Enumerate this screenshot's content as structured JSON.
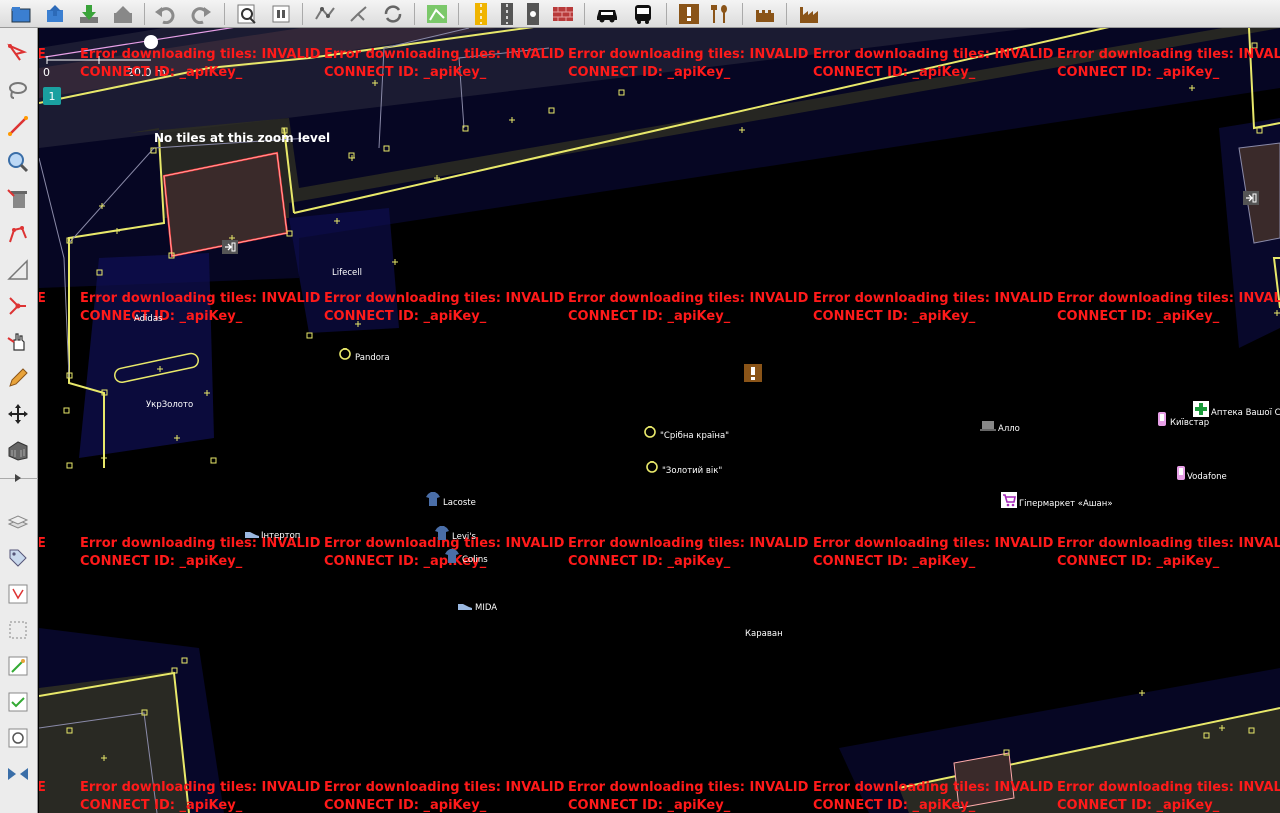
{
  "toolbar": {
    "buttons": [
      {
        "name": "open-file-button",
        "icon": "folder-open-icon"
      },
      {
        "name": "open-location-button",
        "icon": "globe-open-icon"
      },
      {
        "name": "download-button",
        "icon": "download-icon"
      },
      {
        "name": "upload-button",
        "icon": "upload-icon"
      },
      {
        "name": "undo-button",
        "icon": "undo-icon"
      },
      {
        "name": "redo-button",
        "icon": "redo-icon"
      },
      {
        "name": "preferences-button",
        "icon": "magnifier-icon"
      },
      {
        "name": "settings-button",
        "icon": "settings-panel-icon"
      },
      {
        "name": "split-way-button",
        "icon": "split-way-icon"
      },
      {
        "name": "combine-way-button",
        "icon": "combine-way-icon"
      },
      {
        "name": "reverse-way-button",
        "icon": "reverse-arrows-icon"
      },
      {
        "name": "filter-button",
        "icon": "filter-grid-icon"
      },
      {
        "name": "preset-road-button",
        "icon": "road-icon"
      },
      {
        "name": "preset-highway-button",
        "icon": "highway-icon"
      },
      {
        "name": "preset-traffic-light-button",
        "icon": "traffic-light-icon"
      },
      {
        "name": "preset-barrier-button",
        "icon": "brick-wall-icon"
      },
      {
        "name": "preset-car-button",
        "icon": "car-icon"
      },
      {
        "name": "preset-bus-button",
        "icon": "bus-icon"
      },
      {
        "name": "preset-warning-button",
        "icon": "exclamation-icon"
      },
      {
        "name": "preset-food-button",
        "icon": "fork-spoon-icon"
      },
      {
        "name": "preset-castle-button",
        "icon": "castle-icon"
      },
      {
        "name": "preset-factory-button",
        "icon": "factory-icon"
      }
    ]
  },
  "leftbar": {
    "tools": [
      {
        "name": "select-tool",
        "icon": "select-arrow-icon"
      },
      {
        "name": "lasso-tool",
        "icon": "lasso-icon"
      },
      {
        "name": "draw-tool",
        "icon": "draw-line-icon"
      },
      {
        "name": "zoom-tool",
        "icon": "zoom-icon"
      },
      {
        "name": "delete-tool",
        "icon": "delete-bin-icon"
      },
      {
        "name": "align-circle-tool",
        "icon": "align-circle-icon"
      },
      {
        "name": "angle-tool",
        "icon": "angle-icon"
      },
      {
        "name": "node-tool",
        "icon": "node-join-icon"
      },
      {
        "name": "move-hand-tool",
        "icon": "hand-icon"
      },
      {
        "name": "pencil-tool",
        "icon": "pencil-icon"
      },
      {
        "name": "move-tool",
        "icon": "move-arrows-icon"
      },
      {
        "name": "building-tool",
        "icon": "building-icon"
      }
    ],
    "panels": [
      {
        "name": "layers-panel-toggle",
        "icon": "layers-icon"
      },
      {
        "name": "tags-panel-toggle",
        "icon": "tag-icon"
      },
      {
        "name": "relations-panel-toggle",
        "icon": "relation-icon"
      },
      {
        "name": "selection-panel-toggle",
        "icon": "selection-icon"
      },
      {
        "name": "changeset-panel-toggle",
        "icon": "changeset-icon"
      },
      {
        "name": "validation-panel-toggle",
        "icon": "validator-icon"
      },
      {
        "name": "history-panel-toggle",
        "icon": "history-icon"
      },
      {
        "name": "conflict-panel-toggle",
        "icon": "conflict-icon"
      }
    ]
  },
  "map": {
    "error_line1": "Error downloading tiles: INVALID",
    "error_line2": "CONNECT ID: _apiKey_",
    "no_tiles": "No tiles at this zoom level",
    "scale_zero": "0",
    "scale_label": "20.0 m",
    "layer_badge": "1",
    "pois": [
      {
        "label": "Lifecell",
        "icon": "none"
      },
      {
        "label": "Adidas",
        "icon": "none"
      },
      {
        "label": "Pandora",
        "icon": "ring-icon"
      },
      {
        "label": "УкрЗолото",
        "icon": "none"
      },
      {
        "label": "\"Срібна країна\"",
        "icon": "ring-icon"
      },
      {
        "label": "\"Золотий вік\"",
        "icon": "ring-icon"
      },
      {
        "label": "Lacoste",
        "icon": "shirt-icon"
      },
      {
        "label": "Levi's",
        "icon": "shirt-icon"
      },
      {
        "label": "Colins",
        "icon": "shirt-icon"
      },
      {
        "label": "Інтертоп",
        "icon": "shoe-icon"
      },
      {
        "label": "MIDA",
        "icon": "shoe-icon"
      },
      {
        "label": "Алло",
        "icon": "laptop-icon"
      },
      {
        "label": "Київстар",
        "icon": "phone-icon"
      },
      {
        "label": "Vodafone",
        "icon": "phone-icon"
      },
      {
        "label": "Аптека Вашої Сім",
        "icon": "pharmacy-cross-icon"
      },
      {
        "label": "Гіпермаркет «Ашан»",
        "icon": "cart-icon"
      },
      {
        "label": "Караван",
        "icon": "none"
      }
    ]
  },
  "colors": {
    "error_text": "#ff1a1a",
    "road_line": "#e8e86a",
    "way_line": "#8a8aa8",
    "selected_building": "#ff4444",
    "node": "#e8e86a",
    "map_bg": "#000000"
  }
}
